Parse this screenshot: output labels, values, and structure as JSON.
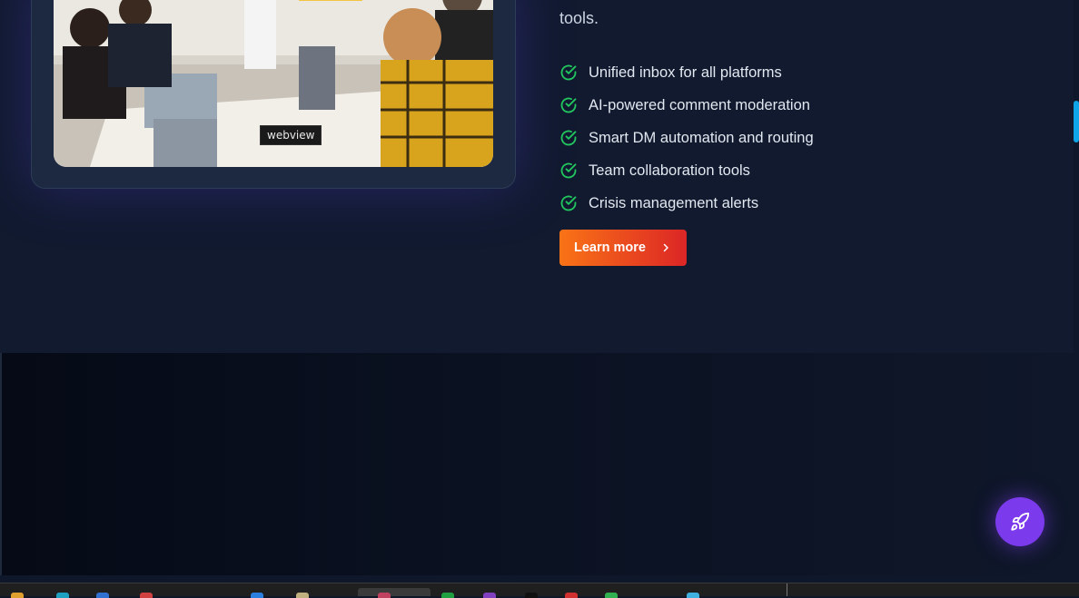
{
  "intro": {
    "tail_text": "tools."
  },
  "features": [
    "Unified inbox for all platforms",
    "AI-powered comment moderation",
    "Smart DM automation and routing",
    "Team collaboration tools",
    "Crisis management alerts"
  ],
  "cta": {
    "label": "Learn more"
  },
  "image": {
    "tooltip": "webview"
  },
  "colors": {
    "accent_start": "#f97316",
    "accent_end": "#dc2626",
    "check": "#22c55e",
    "fab": "#7c3aed",
    "scroll": "#0ea5e9"
  },
  "icons": {
    "check": "check-circle-icon",
    "chevron": "chevron-right-icon",
    "fab": "rocket-icon"
  }
}
